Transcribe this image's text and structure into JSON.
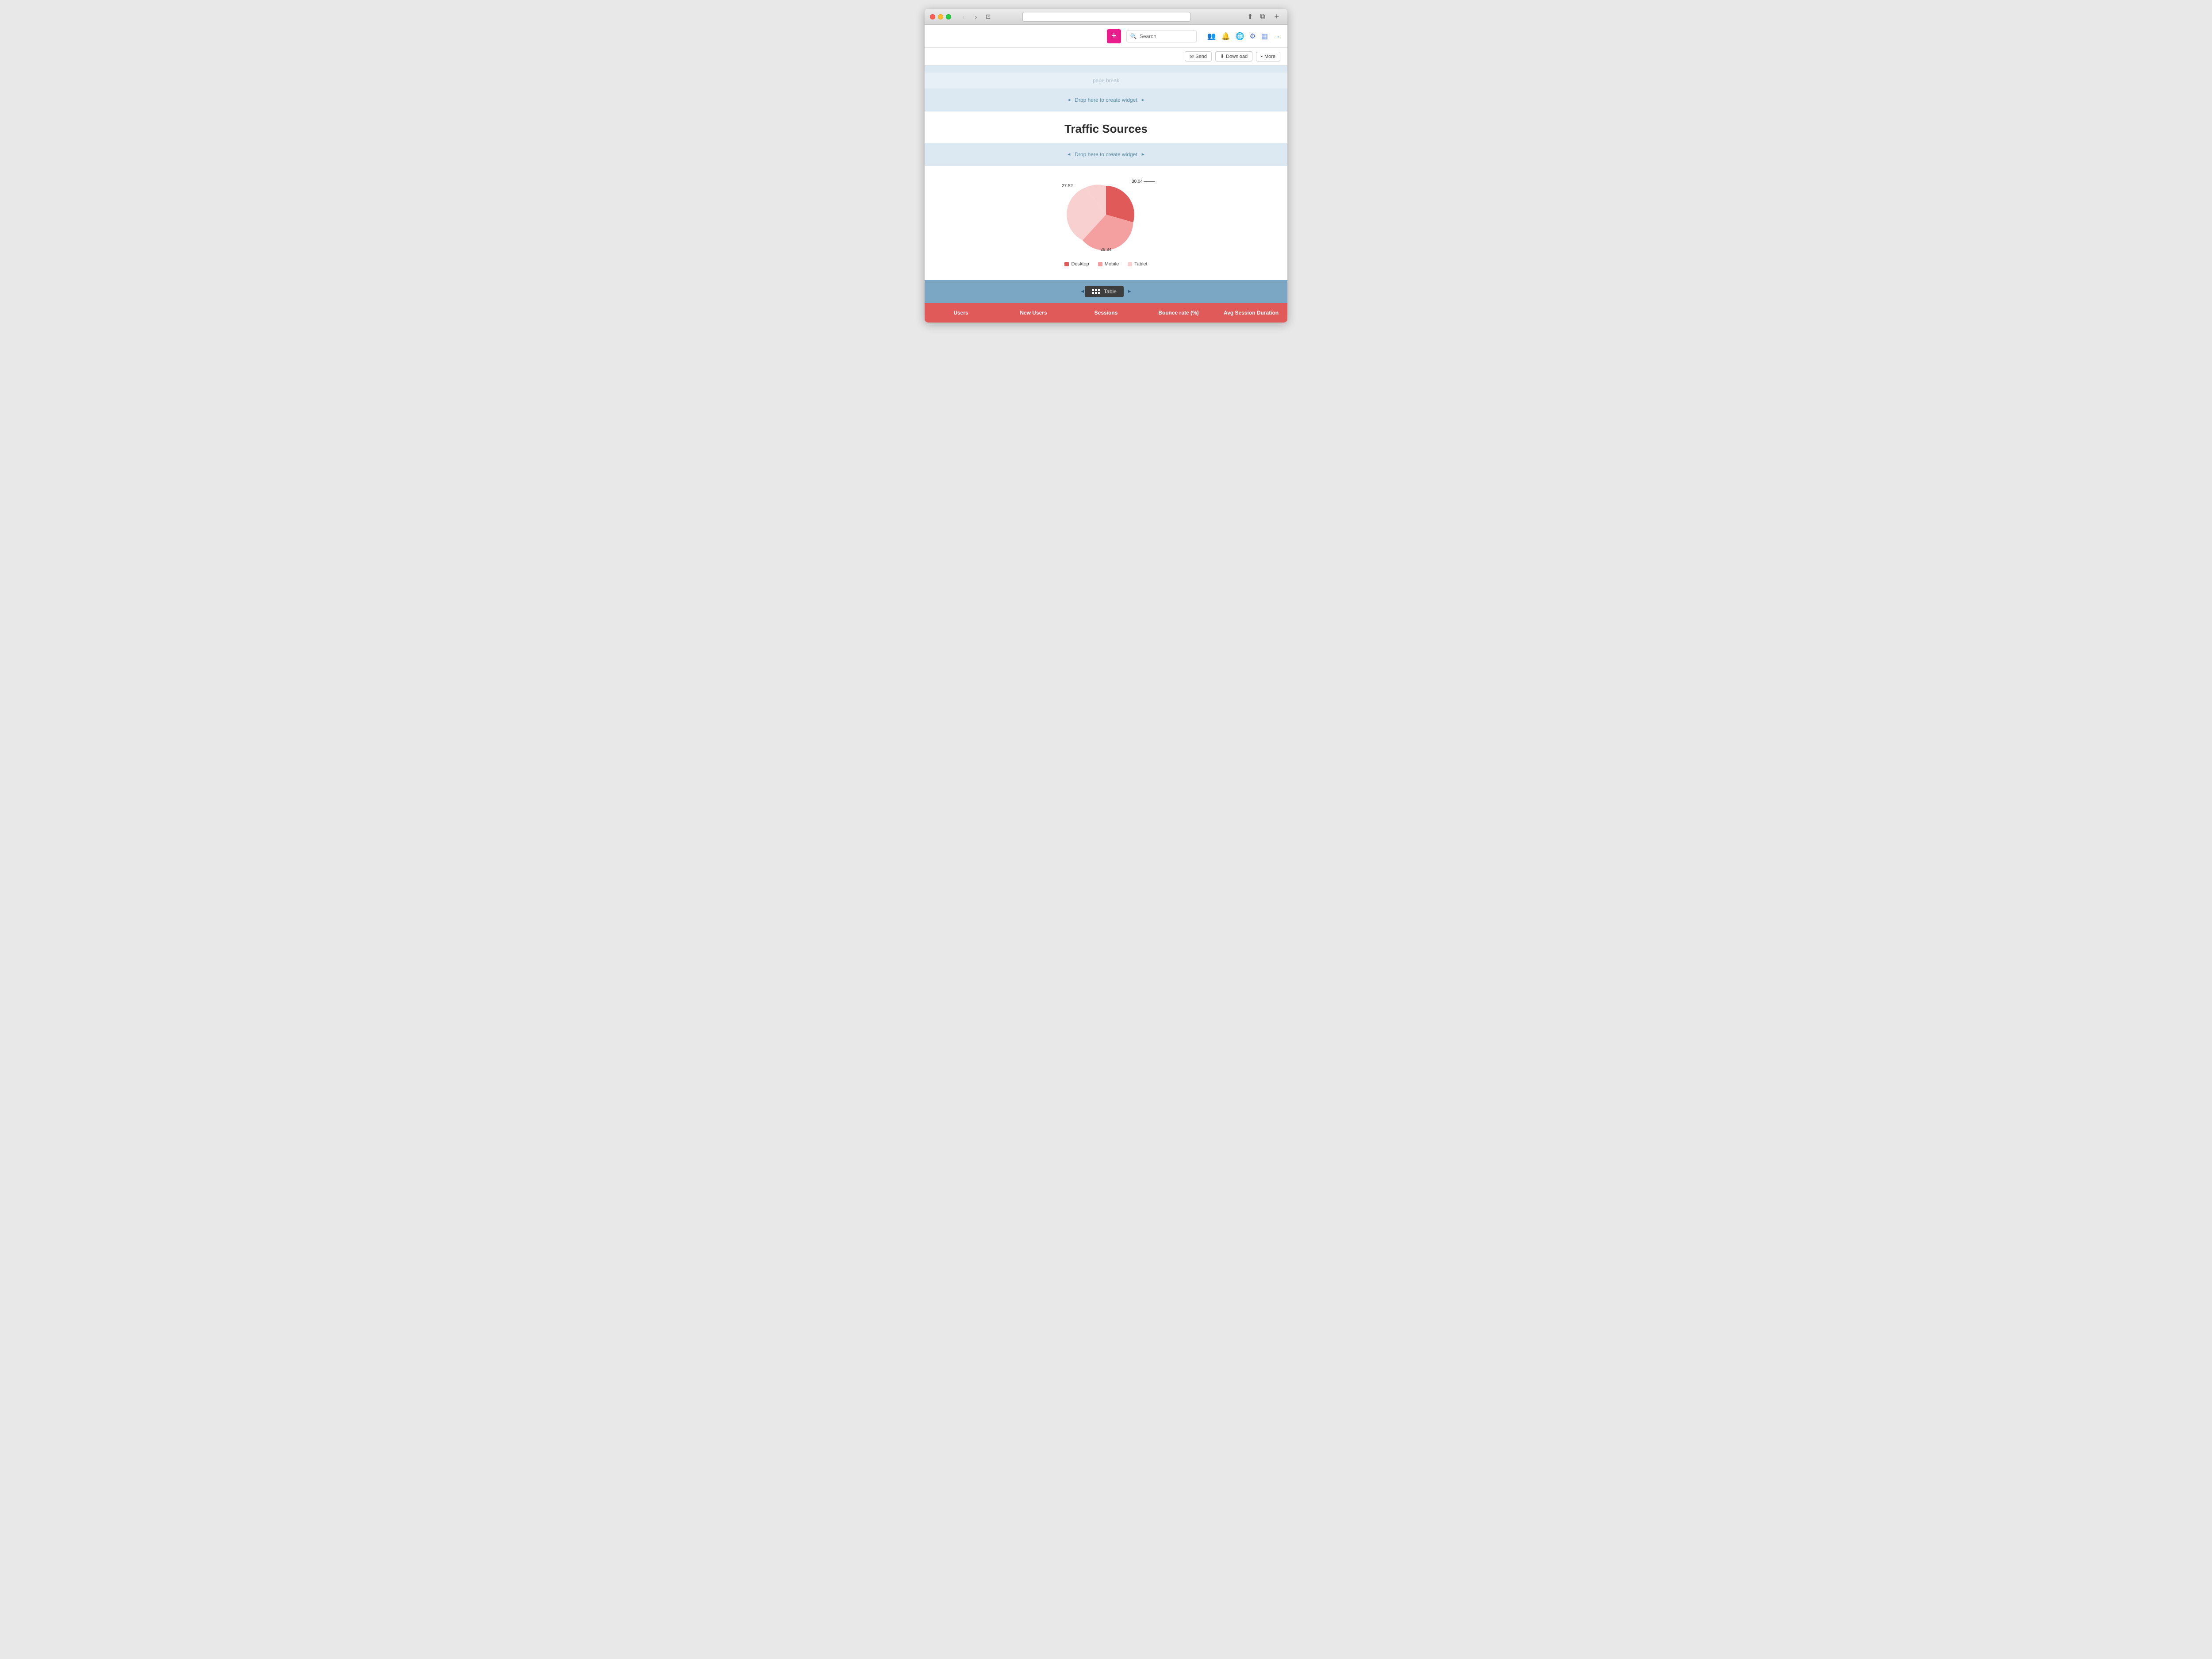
{
  "browser": {
    "traffic_lights": [
      "close",
      "minimize",
      "maximize"
    ],
    "nav_back": "‹",
    "nav_forward": "›",
    "tab_icon": "⊡",
    "new_tab": "+",
    "title_actions": [
      "share",
      "fullscreen",
      "more"
    ]
  },
  "toolbar": {
    "add_label": "+",
    "search_placeholder": "Search",
    "send_label": "Send",
    "download_label": "Download",
    "more_label": "More"
  },
  "page": {
    "page_break_label": "page break",
    "drop_zone_label": "◄ Drop here to create widget ►",
    "section_title": "Traffic Sources",
    "drop_zone2_label": "◄ Drop here to create widget ►",
    "table_label": "Table"
  },
  "chart": {
    "slices": [
      {
        "label": "Desktop",
        "value": 30.04,
        "color": "#e05a5a",
        "percent": 30.04
      },
      {
        "label": "Mobile",
        "value": 29.84,
        "color": "#f4a0a0",
        "percent": 29.84
      },
      {
        "label": "Tablet",
        "value": 27.52,
        "color": "#f9d0d0",
        "percent": 27.52
      }
    ],
    "label_top_left": "27.52",
    "label_top_right": "30.04",
    "label_bottom": "29.84",
    "legend": [
      {
        "label": "Desktop",
        "color": "#e05a5a"
      },
      {
        "label": "Mobile",
        "color": "#f4a0a0"
      },
      {
        "label": "Tablet",
        "color": "#f9d0d0"
      }
    ]
  },
  "data_table": {
    "columns": [
      "Users",
      "New Users",
      "Sessions",
      "Bounce rate (%)",
      "Avg Session Duration"
    ]
  },
  "icons": {
    "search": "🔍",
    "send": "✉",
    "download": "⬇",
    "more_dot": "•",
    "users_icon": "👥",
    "bell_icon": "🔔",
    "globe_icon": "🌐",
    "gear_icon": "⚙",
    "grid_icon": "▦",
    "signout_icon": "→"
  }
}
